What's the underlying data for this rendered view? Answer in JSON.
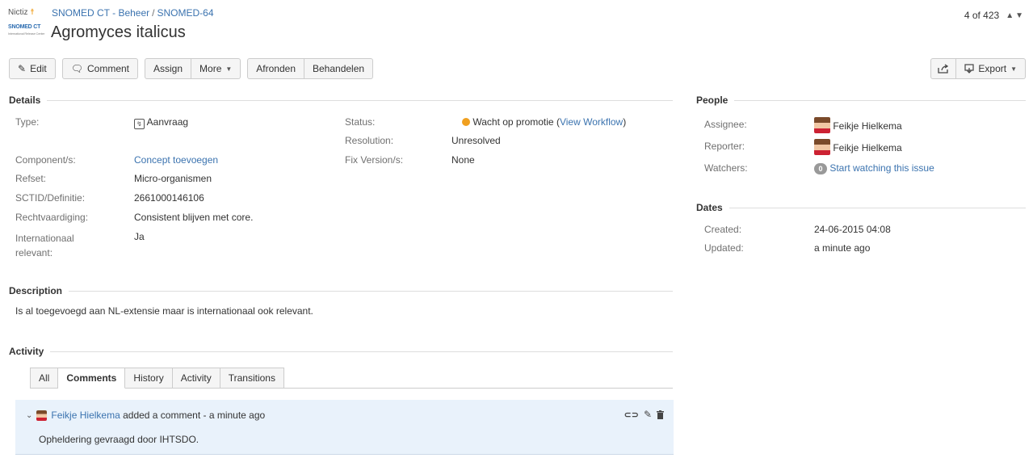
{
  "logo": {
    "org": "Nictiz",
    "product": "SNOMED CT",
    "product_sub": "International Release Center"
  },
  "breadcrumb": {
    "project": "SNOMED CT - Beheer",
    "separator": "/",
    "issue_key": "SNOMED-64"
  },
  "issue": {
    "title": "Agromyces italicus"
  },
  "pager": {
    "text": "4 of 423"
  },
  "toolbar": {
    "edit": "Edit",
    "comment": "Comment",
    "assign": "Assign",
    "more": "More",
    "afronden": "Afronden",
    "behandelen": "Behandelen",
    "export": "Export"
  },
  "details": {
    "heading": "Details",
    "type_label": "Type:",
    "type_value": "Aanvraag",
    "component_label": "Component/s:",
    "component_value": "Concept toevoegen",
    "refset_label": "Refset:",
    "refset_value": "Micro-organismen",
    "sctid_label": "SCTID/Definitie:",
    "sctid_value": "2661000146106",
    "recht_label": "Rechtvaardiging:",
    "recht_value": "Consistent blijven met core.",
    "intl_label_1": "Internationaal",
    "intl_label_2": "relevant:",
    "intl_value": "Ja",
    "status_label": "Status:",
    "status_value": "Wacht op promotie",
    "status_open": "(",
    "status_link": "View Workflow",
    "status_close": ")",
    "resolution_label": "Resolution:",
    "resolution_value": "Unresolved",
    "fix_label": "Fix Version/s:",
    "fix_value": "None"
  },
  "people": {
    "heading": "People",
    "assignee_label": "Assignee:",
    "assignee_value": "Feikje Hielkema",
    "reporter_label": "Reporter:",
    "reporter_value": "Feikje Hielkema",
    "watchers_label": "Watchers:",
    "watchers_count": "0",
    "watchers_link": "Start watching this issue"
  },
  "dates": {
    "heading": "Dates",
    "created_label": "Created:",
    "created_value": "24-06-2015 04:08",
    "updated_label": "Updated:",
    "updated_value": "a minute ago"
  },
  "description": {
    "heading": "Description",
    "text": "Is al toegevoegd aan NL-extensie maar is internationaal ook relevant."
  },
  "activity": {
    "heading": "Activity",
    "tabs": [
      "All",
      "Comments",
      "History",
      "Activity",
      "Transitions"
    ],
    "active_tab": "Comments"
  },
  "comment": {
    "author": "Feikje Hielkema",
    "meta": "added a comment - a minute ago",
    "body": "Opheldering gevraagd door IHTSDO."
  }
}
